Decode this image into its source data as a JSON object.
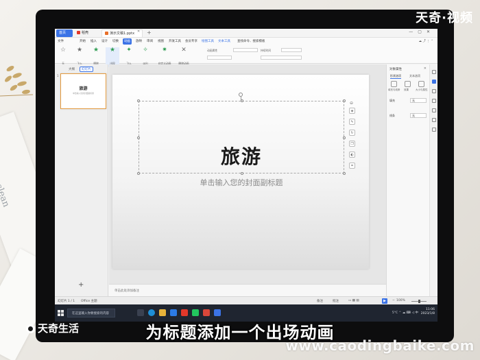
{
  "titlebar": {
    "home_tab": "首页",
    "wps_tab": "稻壳",
    "doc_tab": "演示文稿1.pptx"
  },
  "menubar": {
    "items": [
      "文件",
      "开始",
      "插入",
      "设计",
      "切换",
      "动画",
      "放映",
      "审阅",
      "视图",
      "开发工具",
      "会员专享",
      "绘图工具",
      "文本工具"
    ],
    "active_index": 5,
    "search": "查找命令、搜索模板"
  },
  "ribbon": {
    "buttons": [
      "无",
      "飞入",
      "擦除",
      "出现",
      "飞入",
      "淡出",
      "自定义动画",
      "删除动画"
    ],
    "opts": "动画属性",
    "timing": "持续时间"
  },
  "leftpanel": {
    "tab_outline": "大纲",
    "tab_slides": "幻灯片",
    "thumb_num": "1",
    "thumb_title": "旅游",
    "thumb_sub": "单击输入您的封面副标题"
  },
  "slide": {
    "title": "旅游",
    "subtitle": "单击输入您的封面副标题"
  },
  "notes": {
    "placeholder": "单击此处添加备注"
  },
  "rightpane": {
    "title": "对象属性",
    "tab_fill": "形状选项",
    "tab_text": "文本选项",
    "icon_labels": [
      "填充与线条",
      "效果",
      "大小与属性"
    ],
    "row_fill": "填充",
    "row_fill_val": "无",
    "row_line": "线条",
    "row_line_val": "无"
  },
  "statusbar": {
    "page": "幻灯片 1 / 1",
    "theme": "Office 主题",
    "notes_btn": "备注",
    "comment_btn": "批注",
    "zoom": "100%"
  },
  "taskbar": {
    "search_placeholder": "在这里输入你要搜索的内容",
    "weather": "5°C",
    "time": "11:06",
    "date": "2023/1/8",
    "lang": "中"
  },
  "overlay": {
    "brand_top": "天奇·视频",
    "brand_bottom": "天奇生活",
    "caption": "为标题添加一个出场动画",
    "watermark": "www.caodingbaike.com"
  },
  "background": {
    "paper_text": "producing clean"
  },
  "colors": {
    "accent": "#3b73e6",
    "thumb_border": "#e49a3e",
    "taskbar": "#1f2530"
  }
}
